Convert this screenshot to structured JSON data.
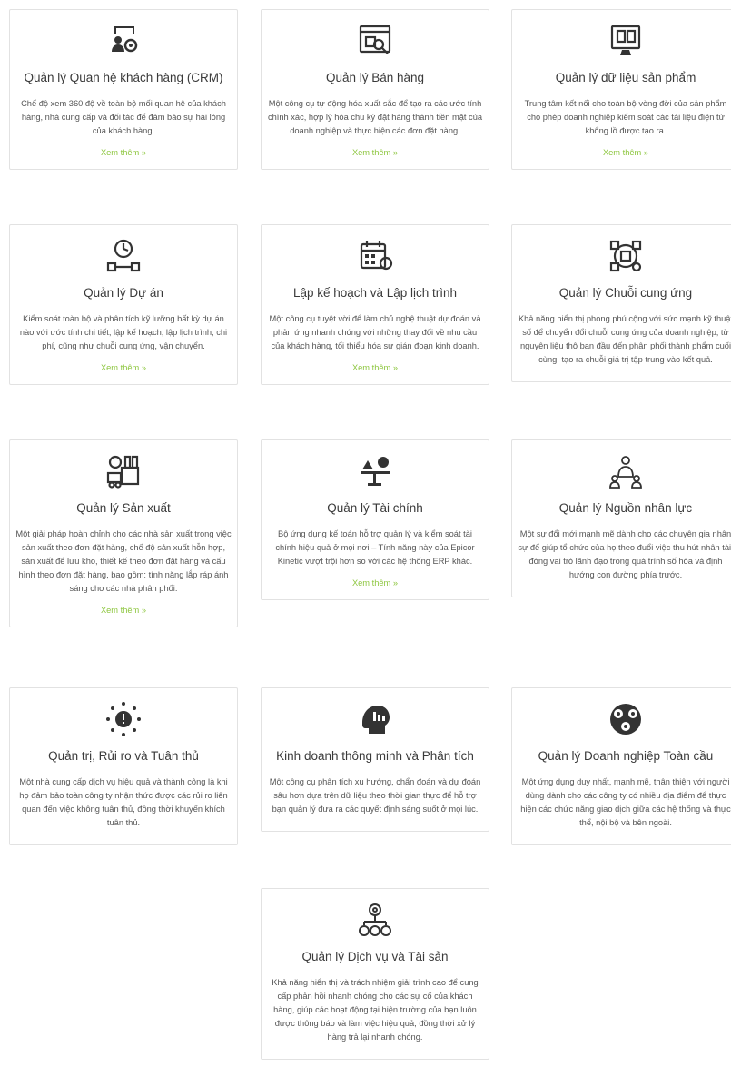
{
  "cards": [
    {
      "icon": "crm-icon",
      "title": "Quản lý Quan hệ khách hàng (CRM)",
      "desc": "Chế độ xem 360 độ về toàn bộ mối quan hệ của khách hàng, nhà cung cấp và đối tác để đảm bảo sự hài lòng của khách hàng.",
      "more": "Xem thêm »"
    },
    {
      "icon": "sales-icon",
      "title": "Quản lý Bán hàng",
      "desc": "Một công cụ tự động hóa xuất sắc để tạo ra các ước tính chính xác, hợp lý hóa chu kỳ đặt hàng thành tiền mặt của doanh nghiệp và thực hiện các đơn đặt hàng.",
      "more": "Xem thêm »"
    },
    {
      "icon": "product-data-icon",
      "title": "Quản lý dữ liệu sản phẩm",
      "desc": "Trung tâm kết nối cho toàn bộ vòng đời của sản phẩm cho phép doanh nghiệp kiểm soát các tài liệu điện tử khổng lồ được tạo ra.",
      "more": "Xem thêm »"
    },
    {
      "icon": "project-icon",
      "title": "Quản lý Dự án",
      "desc": "Kiểm soát toàn bộ và phân tích kỹ lưỡng bất kỳ dự án nào với ước tính chi tiết, lập kế hoạch, lập lịch trình, chi phí, cũng như chuỗi cung ứng, vận chuyển.",
      "more": "Xem thêm »"
    },
    {
      "icon": "calendar-icon",
      "title": "Lập kế hoạch và Lập lịch trình",
      "desc": "Một công cụ tuyệt vời để làm chủ nghệ thuật dự đoán và phản ứng nhanh chóng với những thay đổi về nhu cầu của khách hàng, tối thiểu hóa sự gián đoạn kinh doanh.",
      "more": "Xem thêm »"
    },
    {
      "icon": "supply-chain-icon",
      "title": "Quản lý Chuỗi cung ứng",
      "desc": "Khả năng hiển thị phong phú cộng với sức mạnh kỹ thuật số để chuyển đổi chuỗi cung ứng của doanh nghiệp, từ nguyên liệu thô ban đầu đến phân phối thành phẩm cuối cùng, tạo ra chuỗi giá trị tập trung vào kết quả.",
      "more": ""
    },
    {
      "icon": "factory-icon",
      "title": "Quản lý Sản xuất",
      "desc": "Một giải pháp hoàn chỉnh cho các nhà sản xuất trong việc sản xuất theo đơn đặt hàng, chế độ sản xuất hỗn hợp, sản xuất để lưu kho, thiết kế theo đơn đặt hàng và cấu hình theo đơn đặt hàng, bao gồm: tính năng lắp ráp ánh sáng cho các nhà phân phối.",
      "more": "Xem thêm »"
    },
    {
      "icon": "finance-icon",
      "title": "Quản lý Tài chính",
      "desc": "Bộ ứng dụng kế toán hỗ trợ quản lý và kiểm soát tài chính hiệu quả ở mọi nơi – Tính năng này của Epicor Kinetic vượt trội hơn so với các hệ thống ERP khác.",
      "more": "Xem thêm »"
    },
    {
      "icon": "hr-icon",
      "title": "Quản lý Nguồn nhân lực",
      "desc": "Một sự đổi mới mạnh mẽ dành cho các chuyên gia nhân sự để giúp tổ chức của họ theo đuổi việc thu hút nhân tài, đóng vai trò lãnh đạo trong quá trình số hóa và định hướng con đường phía trước.",
      "more": ""
    },
    {
      "icon": "risk-icon",
      "title": "Quản trị, Rủi ro và Tuân thủ",
      "desc": "Một nhà cung cấp dịch vụ hiệu quả và thành công là khi họ đảm bảo toàn công ty nhận thức được các rủi ro liên quan đến việc không tuân thủ, đồng thời khuyến khích tuân thủ.",
      "more": ""
    },
    {
      "icon": "bi-icon",
      "title": "Kinh doanh thông minh và Phân tích",
      "desc": "Một công cụ phân tích xu hướng, chẩn đoán và dự đoán sâu hơn dựa trên dữ liệu theo thời gian thực để hỗ trợ bạn quản lý đưa ra các quyết định sáng suốt ở mọi lúc.",
      "more": ""
    },
    {
      "icon": "global-icon",
      "title": "Quản lý Doanh nghiệp Toàn cầu",
      "desc": "Một ứng dụng duy nhất, mạnh mẽ, thân thiện với người dùng dành cho các công ty có nhiều địa điểm để thực hiện các chức năng giao dịch giữa các hệ thống và thực thể, nội bộ và bên ngoài.",
      "more": ""
    },
    {
      "icon": "service-asset-icon",
      "title": "Quản lý Dịch vụ và Tài sản",
      "desc": "Khả năng hiển thị và trách nhiệm giải trình cao để cung cấp phản hồi nhanh chóng cho các sự cố của khách hàng, giúp các hoạt động tại hiện trường của bạn luôn được thông báo và làm việc hiệu quả, đồng thời xử lý hàng trả lại nhanh chóng.",
      "more": ""
    }
  ]
}
